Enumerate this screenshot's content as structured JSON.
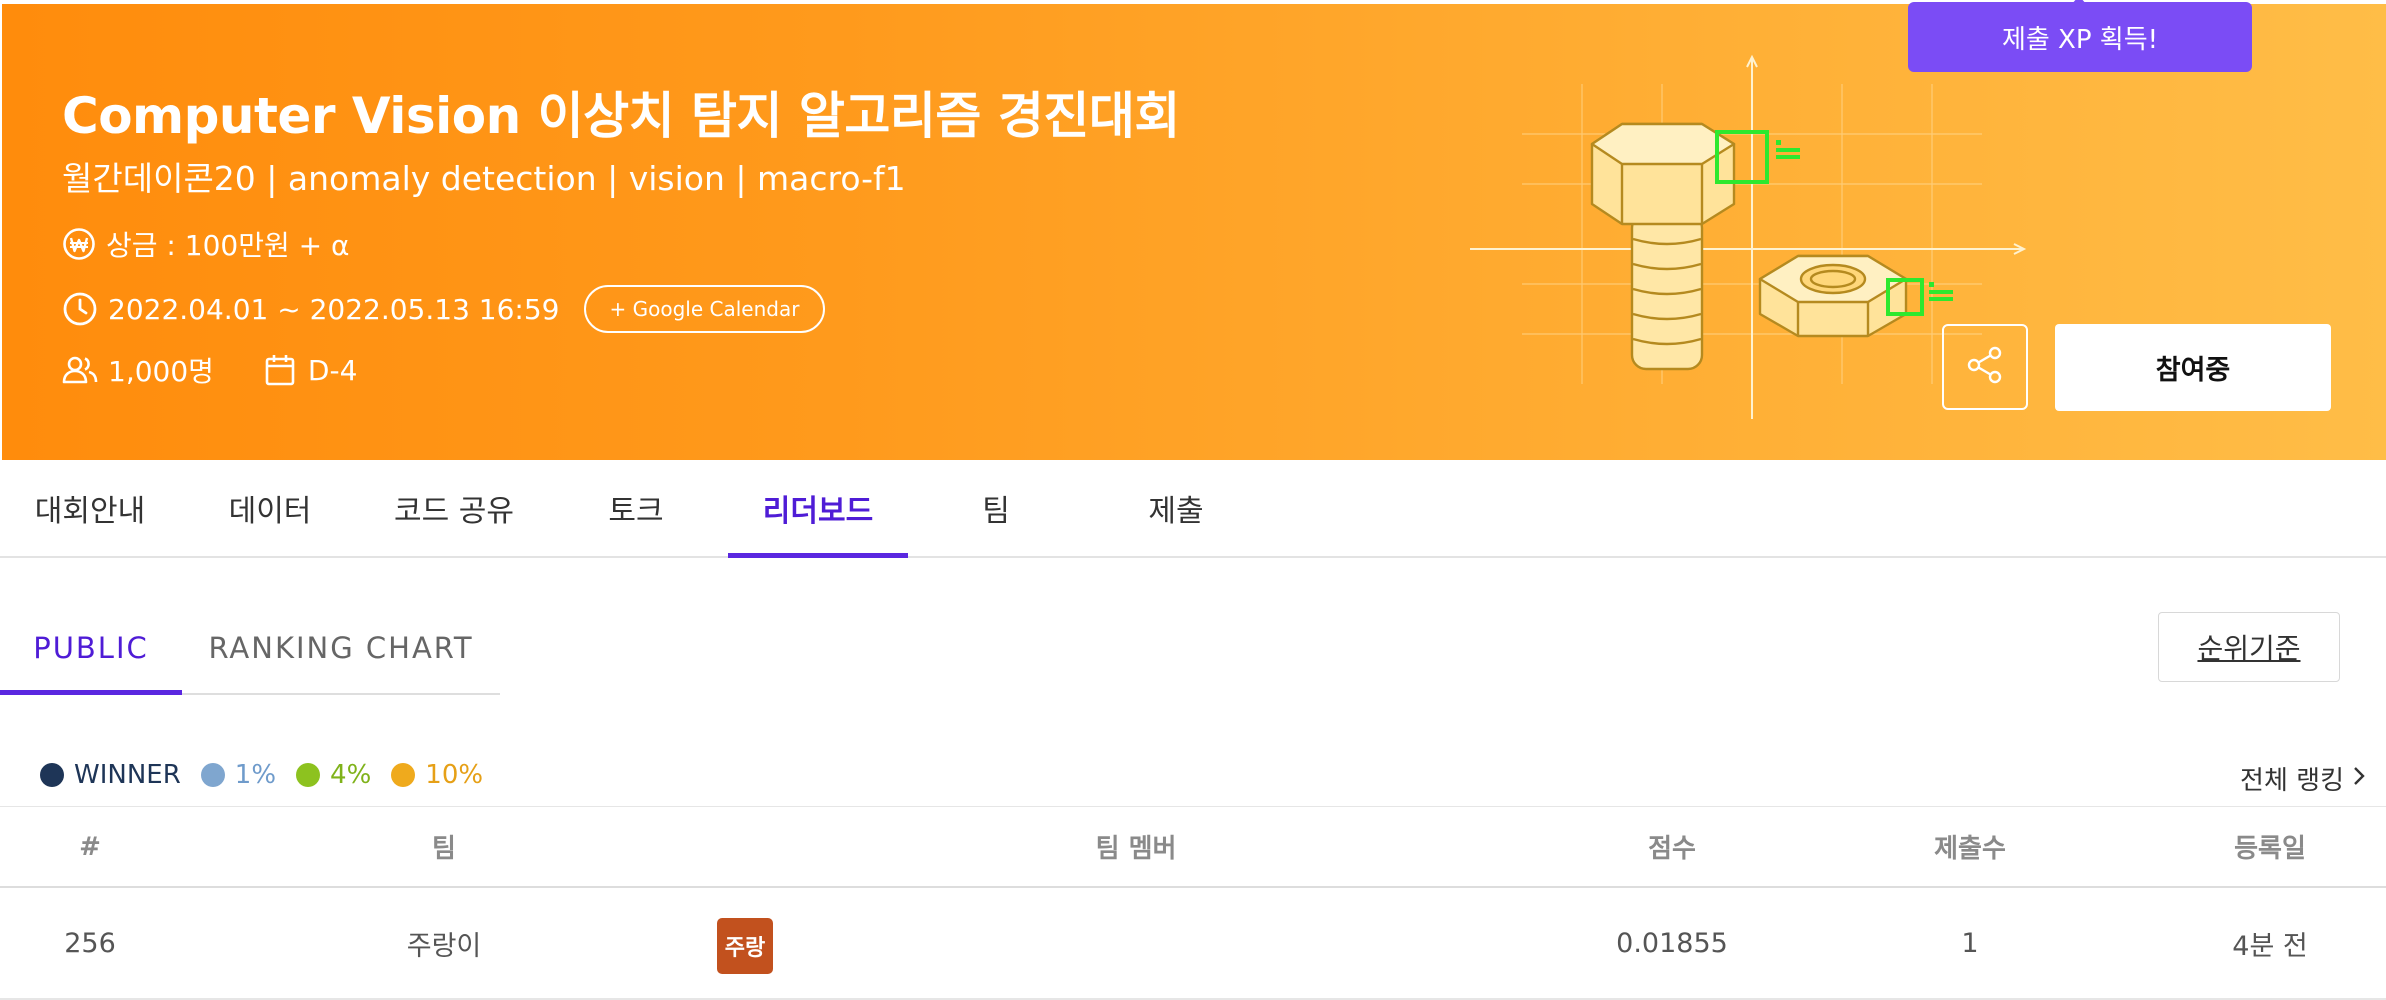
{
  "hero": {
    "title": "Computer Vision 이상치 탐지 알고리즘 경진대회",
    "subtitle": "월간데이콘20 | anomaly detection | vision | macro-f1",
    "prize": "상금 : 100만원 + α",
    "period": "2022.04.01 ~ 2022.05.13 16:59",
    "google_calendar_label": "+ Google Calendar",
    "participants": "1,000명",
    "dday": "D-4",
    "join_label": "참여중",
    "xp_badge": "제출 XP 획득!",
    "background_colors": [
      "#ff8c0c",
      "#ffbd47"
    ],
    "icons": [
      "won-icon",
      "clock-icon",
      "people-icon",
      "calendar-icon",
      "share-icon"
    ]
  },
  "main_tabs": [
    {
      "label": "대회안내",
      "active": false
    },
    {
      "label": "데이터",
      "active": false
    },
    {
      "label": "코드 공유",
      "active": false
    },
    {
      "label": "토크",
      "active": false
    },
    {
      "label": "리더보드",
      "active": true
    },
    {
      "label": "팀",
      "active": false
    },
    {
      "label": "제출",
      "active": false
    }
  ],
  "sub_tabs": [
    {
      "label": "PUBLIC",
      "active": true
    },
    {
      "label": "RANKING CHART",
      "active": false
    }
  ],
  "rank_basis_label": "순위기준",
  "legend": [
    {
      "label": "WINNER",
      "color": "#1e3557"
    },
    {
      "label": "1%",
      "color": "#7fa6cf"
    },
    {
      "label": "4%",
      "color": "#8dc21f"
    },
    {
      "label": "10%",
      "color": "#efaa1d"
    }
  ],
  "full_ranking_label": "전체 랭킹",
  "leaderboard": {
    "columns": [
      "#",
      "팀",
      "팀 멤버",
      "점수",
      "제출수",
      "등록일"
    ],
    "rows": [
      {
        "rank": "256",
        "team": "주랑이",
        "member_avatar": "주랑",
        "score": "0.01855",
        "submissions": "1",
        "registered": "4분 전"
      }
    ]
  },
  "accent_color": "#5a27e0"
}
